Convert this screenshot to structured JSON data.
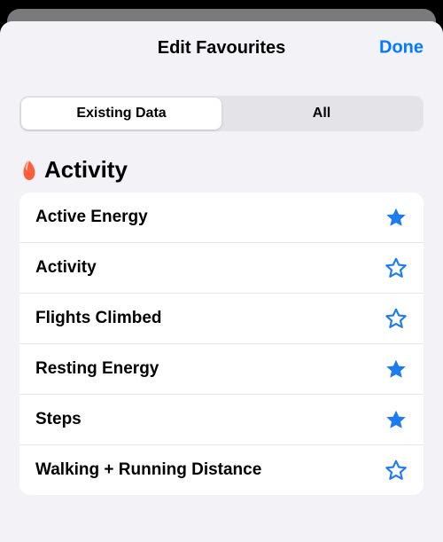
{
  "header": {
    "title": "Edit Favourites",
    "done": "Done"
  },
  "segmented": {
    "existing": "Existing Data",
    "all": "All",
    "selected": "existing"
  },
  "section": {
    "title": "Activity",
    "icon": "flame-icon",
    "icon_color": "#ff3b30"
  },
  "items": [
    {
      "label": "Active Energy",
      "favourite": true
    },
    {
      "label": "Activity",
      "favourite": false
    },
    {
      "label": "Flights Climbed",
      "favourite": false
    },
    {
      "label": "Resting Energy",
      "favourite": true
    },
    {
      "label": "Steps",
      "favourite": true
    },
    {
      "label": "Walking + Running Distance",
      "favourite": false
    }
  ],
  "colors": {
    "accent_blue": "#007aff",
    "star_blue": "#1e7cf0"
  }
}
